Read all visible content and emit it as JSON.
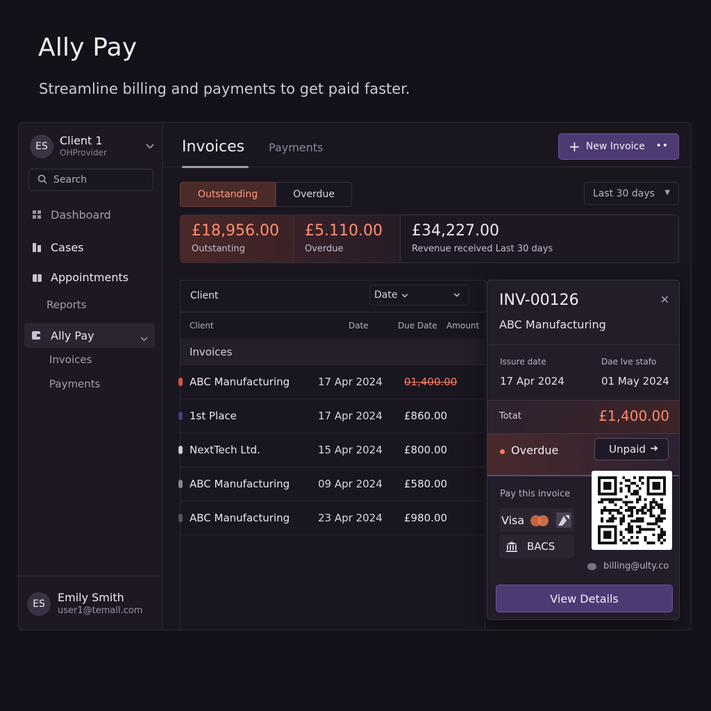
{
  "hero": {
    "title": "Ally Pay",
    "subtitle": "Streamline billing and payments to get paid faster."
  },
  "sidebar": {
    "client": {
      "initials": "ES",
      "name": "Client 1",
      "sub": "OHProvider"
    },
    "search_label": "Search",
    "items": [
      {
        "label": "Dashboard",
        "icon": "grid-icon"
      },
      {
        "label": "Cases",
        "icon": "folder-icon"
      },
      {
        "label": "Appointments",
        "icon": "calendar-icon"
      },
      {
        "label": "Reports"
      },
      {
        "label": "Ally Pay",
        "icon": "wallet-icon"
      }
    ],
    "sub_items": [
      "Invoices",
      "Payments"
    ],
    "user": {
      "initials": "ES",
      "name": "Emily Smith",
      "email": "user1@temall.com"
    }
  },
  "main": {
    "tabs": [
      "Invoices",
      "Payments"
    ],
    "new_invoice_label": "New Invoice",
    "filters": [
      "Outstanding",
      "Overdue"
    ],
    "range_label": "Last 30 days",
    "stats": [
      {
        "value": "£18,956.00",
        "label": "Outstanting"
      },
      {
        "value": "£5.110.00",
        "label": "Overdue"
      },
      {
        "value": "£34,227.00",
        "label": "Revenue received Last 30 days"
      }
    ]
  },
  "table": {
    "client_label": "Client",
    "date_filter": "Date",
    "columns": [
      "Client",
      "Date",
      "Due Date",
      "Amount"
    ],
    "group": "Invoices",
    "rows": [
      {
        "client": "ABC Manufacturing",
        "date": "17 Apr 2024",
        "amount": "01,400.00",
        "dot": "#d4553f"
      },
      {
        "client": "1st Place",
        "date": "17 Apr 2024",
        "amount": "£860.00",
        "dot": "#4a3a7a"
      },
      {
        "client": "NextTech Ltd.",
        "date": "15 Apr 2024",
        "amount": "£800.00",
        "dot": "#cfc8d8"
      },
      {
        "client": "ABC Manufacturing",
        "date": "09 Apr 2024",
        "amount": "£580.00",
        "dot": "#8a8294"
      },
      {
        "client": "ABC Manufacturing",
        "date": "23 Apr 2024",
        "amount": "£980.00",
        "dot": "#5a5262"
      }
    ]
  },
  "detail": {
    "invoice_no": "INV-00126",
    "company": "ABC Manufacturing",
    "issue_label": "Issure date",
    "issue_date": "17 Apr 2024",
    "due_label": "Dae lve stafo",
    "due_date": "01 May 2024",
    "total_label": "Totat",
    "total_value": "£1,400.00",
    "status": "Overdue",
    "status_action": "Unpaid",
    "pay_label": "Pay this invoice",
    "pay_methods": [
      "Visa",
      "BACS"
    ],
    "email": "billing@ulty.co",
    "view_label": "View Details"
  },
  "colors": {
    "accent": "#4d3a73",
    "overdue": "#ff8a6a"
  }
}
